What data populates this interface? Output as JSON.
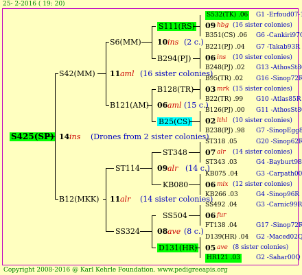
{
  "header_date": "25-  2-2016 ( 19: 20)",
  "root": "S425(SP)",
  "root_num": "14",
  "root_race": "ins",
  "root_note": "(Drones from 2 sister colonies)",
  "mid": {
    "top": {
      "id": "S42(MM)",
      "num": "11",
      "race": "aml",
      "note": "(16 sister colonies)"
    },
    "bot": {
      "id": "B12(MKK)",
      "num": "11",
      "race": "alr",
      "note": "(14 sister colonies)"
    }
  },
  "g3": {
    "a": {
      "id": "S6(MM)",
      "num": "10",
      "race": "ins",
      "note": "(2 c.)"
    },
    "b": {
      "id": "B121(AM)",
      "num": "06",
      "race": "aml",
      "note": "(15 c.)"
    },
    "c": {
      "id": "ST114",
      "num": "09",
      "race": "alr",
      "note": "(14 c.)"
    },
    "d": {
      "id": "SS324",
      "num": "08",
      "race": "ave",
      "note": "(8 c.)"
    }
  },
  "g4": {
    "a1": "S111(RS)",
    "a2": "B294(PJ)",
    "b1": "B128(TR)",
    "b2": "B25(CS)",
    "c1": "ST348",
    "c2": "KB080",
    "d1": "SS504",
    "d2": "D131(HR)"
  },
  "g5": [
    {
      "l1": "S532(TK) .06",
      "l1r": "G1 -Erfoud07-1Q",
      "num": "09",
      "race": "hbg",
      "note": "(16 sister colonies)",
      "l3": "B351(CS) .06",
      "l3r": "G6 -Cankiri97Q"
    },
    {
      "l1": "B221(PJ) .04",
      "l1r": "G7 -Takab93R",
      "num": "06",
      "race": "ins",
      "note": "(10 sister colonies)",
      "l3": "B248(PJ) .02",
      "l3r": "G13 -AthosSt80R"
    },
    {
      "l1": "B95(TR) .02",
      "l1r": "G16 -Sinop72R",
      "num": "03",
      "race": "mrk",
      "note": "(15 sister colonies)",
      "l3": "B22(TR) .99",
      "l3r": "G10 -Atlas85R"
    },
    {
      "l1": "B126(PJ) .00",
      "l1r": "G11 -AthosSt80R",
      "num": "02",
      "race": "lthl",
      "note": "(10 sister colonies)",
      "l3": "B238(PJ) .98",
      "l3r": "G7 -SinopEgg86R"
    },
    {
      "l1": "ST318 .05",
      "l1r": "G20 -Sinop62R",
      "num": "07",
      "race": "alr",
      "note": "(14 sister colonies)",
      "l3": "ST343 .03",
      "l3r": "G4 -Bayburt98-3"
    },
    {
      "l1": "KB075 .04",
      "l1r": "G3 -Carpath00R",
      "num": "06",
      "race": "mix",
      "note": "(12 sister colonies)",
      "l3": "KB266 .03",
      "l3r": "G4 -Sinop96R"
    },
    {
      "l1": "SS492 .04",
      "l1r": "G3 -Carnic99R",
      "num": "06",
      "race": "fur",
      "note": "",
      "l3": "FT138 .04",
      "l3r": "G17 -Sinop72R"
    },
    {
      "l1": "D139(HR) .04",
      "l1r": "G2 -Maced02Q",
      "num": "05",
      "race": "ave",
      "note": "(8 sister colonies)",
      "l3": "HR121 .03",
      "l3r": "G2 -Sahar00Q"
    }
  ],
  "footer": "Copyright 2008-2016 @ Karl Kehrle Foundation.   www.pedigreeapis.org"
}
